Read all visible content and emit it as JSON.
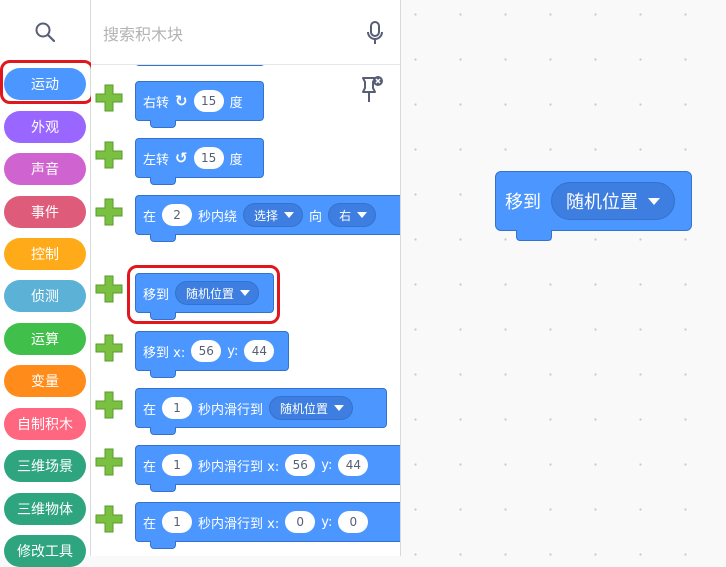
{
  "search": {
    "placeholder": "搜索积木块"
  },
  "categories": [
    {
      "label": "运动",
      "color": "#4c97ff"
    },
    {
      "label": "外观",
      "color": "#9966ff"
    },
    {
      "label": "声音",
      "color": "#cf63cf"
    },
    {
      "label": "事件",
      "color": "#de5c7a"
    },
    {
      "label": "控制",
      "color": "#ffab19"
    },
    {
      "label": "侦测",
      "color": "#5cb1d6"
    },
    {
      "label": "运算",
      "color": "#40bf4a"
    },
    {
      "label": "变量",
      "color": "#ff8c1a"
    },
    {
      "label": "自制积木",
      "color": "#ff6680"
    },
    {
      "label": "三维场景",
      "color": "#2fa57f"
    },
    {
      "label": "三维物体",
      "color": "#2fa57f"
    },
    {
      "label": "修改工具",
      "color": "#2fa57f"
    }
  ],
  "palette": {
    "turn_right": {
      "label": "右转",
      "value": "15",
      "unit": "度"
    },
    "turn_left": {
      "label": "左转",
      "value": "15",
      "unit": "度"
    },
    "rotate_around": {
      "pre": "在",
      "value": "2",
      "mid": "秒内绕",
      "target": "选择",
      "dir_label": "向",
      "dir": "右"
    },
    "go_to": {
      "label": "移到",
      "target": "随机位置"
    },
    "go_to_xy": {
      "label": "移到 x:",
      "x": "56",
      "ylabel": "y:",
      "y": "44"
    },
    "glide_to": {
      "pre": "在",
      "value": "1",
      "mid": "秒内滑行到",
      "target": "随机位置"
    },
    "glide_xy": {
      "pre": "在",
      "value": "1",
      "mid": "秒内滑行到 x:",
      "x": "56",
      "ylabel": "y:",
      "y": "44"
    },
    "glide_xy0": {
      "pre": "在",
      "value": "1",
      "mid": "秒内滑行到 x:",
      "x": "0",
      "ylabel": "y:",
      "y": "0"
    }
  },
  "workspace": {
    "go_to": {
      "label": "移到",
      "target": "随机位置"
    }
  },
  "colors": {
    "motion": "#4c97ff",
    "highlight": "#e0171d",
    "plus": "#7ac142"
  }
}
